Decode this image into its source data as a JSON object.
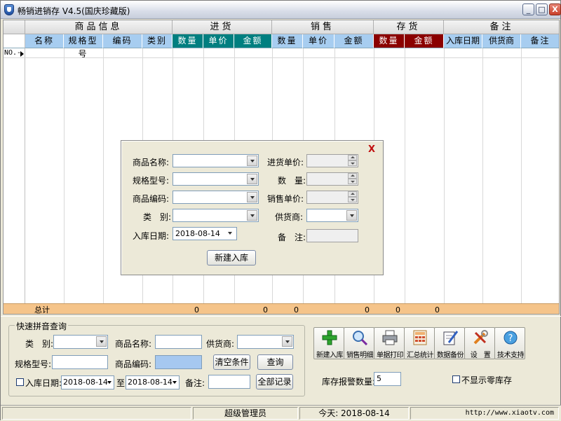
{
  "window": {
    "title": "畅销进销存 V4.5(国庆珍藏版)",
    "min": "_",
    "max": "□",
    "close": "X"
  },
  "grid": {
    "groups": [
      "商品信息",
      "进货",
      "销售",
      "存货",
      "备注"
    ],
    "columns": [
      "名称",
      "规格型号",
      "编码",
      "类别",
      "数量",
      "单价",
      "金额",
      "数量",
      "单价",
      "金额",
      "数量",
      "金额",
      "入库日期",
      "供货商",
      "备注"
    ],
    "row_label": "NO.-",
    "total_label": "总计",
    "totals": [
      "0",
      "0",
      "0",
      "0",
      "0",
      "0"
    ]
  },
  "dialog": {
    "name_label": "商品名称:",
    "spec_label": "规格型号:",
    "code_label": "商品编码:",
    "category_label": "类　别:",
    "date_label": "入库日期:",
    "date_value": "2018-08-14",
    "in_price_label": "进货单价:",
    "qty_label": "数　量:",
    "sale_price_label": "销售单价:",
    "supplier_label": "供货商:",
    "note_label": "备　注:",
    "submit": "新建入库",
    "close": "X"
  },
  "quick_search": {
    "title": "快速拼音查询",
    "category_label": "类　别:",
    "name_label": "商品名称:",
    "supplier_label": "供货商:",
    "spec_label": "规格型号:",
    "code_label": "商品编码:",
    "clear": "清空条件",
    "query": "查询",
    "date_label": "入库日期:",
    "date_from": "2018-08-14",
    "to_label": "至",
    "date_to": "2018-08-14",
    "note_label": "备注:",
    "all_records": "全部记录"
  },
  "toolbar": [
    {
      "label": "新建入库",
      "icon": "plus-icon"
    },
    {
      "label": "销售明细",
      "icon": "magnifier-icon"
    },
    {
      "label": "单据打印",
      "icon": "printer-icon"
    },
    {
      "label": "汇总统计",
      "icon": "calculator-icon"
    },
    {
      "label": "数据备份",
      "icon": "edit-icon"
    },
    {
      "label": "设　置",
      "icon": "tools-icon"
    },
    {
      "label": "技术支持",
      "icon": "support-icon"
    }
  ],
  "alert": {
    "label": "库存报警数量:",
    "value": "5"
  },
  "hide_zero": {
    "label": "不显示零库存",
    "checked": false
  },
  "status": {
    "user": "超级管理员",
    "today": "今天: 2018-08-14",
    "url": "http://www.xiaotv.com"
  }
}
